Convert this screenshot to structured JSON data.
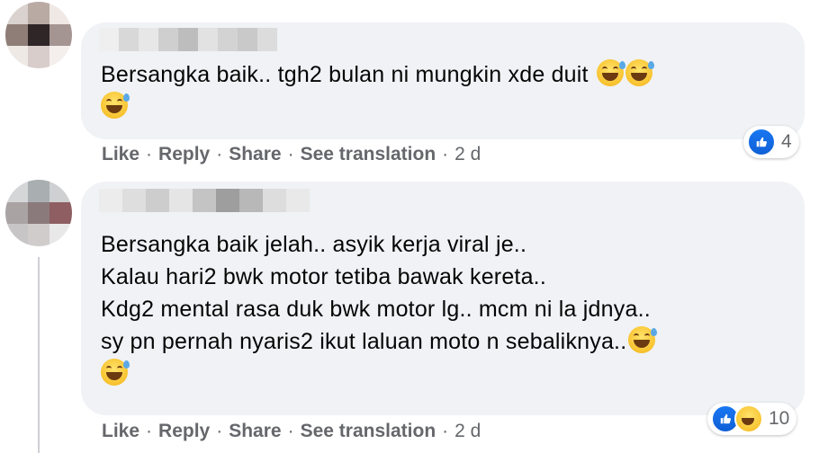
{
  "comments": [
    {
      "text_lines": [
        "Bersangka baik.. tgh2 bulan ni mungkin xde duit"
      ],
      "actions": {
        "like": "Like",
        "reply": "Reply",
        "share": "Share",
        "translate": "See translation",
        "time": "2 d"
      },
      "reaction_count": "4",
      "reaction_icons": [
        "like-icon"
      ],
      "avatar_colors": [
        "#d9d2ce",
        "#b9aaa4",
        "#efe8e5",
        "#8f7d78",
        "#2f2727",
        "#a59592",
        "#efe9e6",
        "#d8cdca",
        "#f4efed"
      ]
    },
    {
      "text_lines": [
        "Bersangka baik jelah.. asyik kerja viral je..",
        "Kalau hari2 bwk motor tetiba bawak kereta..",
        "Kdg2 mental rasa duk bwk motor lg.. mcm ni la jdnya..",
        "sy pn pernah nyaris2 ikut laluan moto n sebaliknya.."
      ],
      "actions": {
        "like": "Like",
        "reply": "Reply",
        "share": "Share",
        "translate": "See translation",
        "time": "2 d"
      },
      "reaction_count": "10",
      "reaction_icons": [
        "like-icon",
        "haha-icon"
      ],
      "avatar_colors": [
        "#d5d6d7",
        "#a9aeb1",
        "#cfd0d1",
        "#a9a3a4",
        "#8b7a7c",
        "#8e5e62",
        "#c7c5c6",
        "#d0cccc",
        "#e9e8e8"
      ]
    }
  ]
}
